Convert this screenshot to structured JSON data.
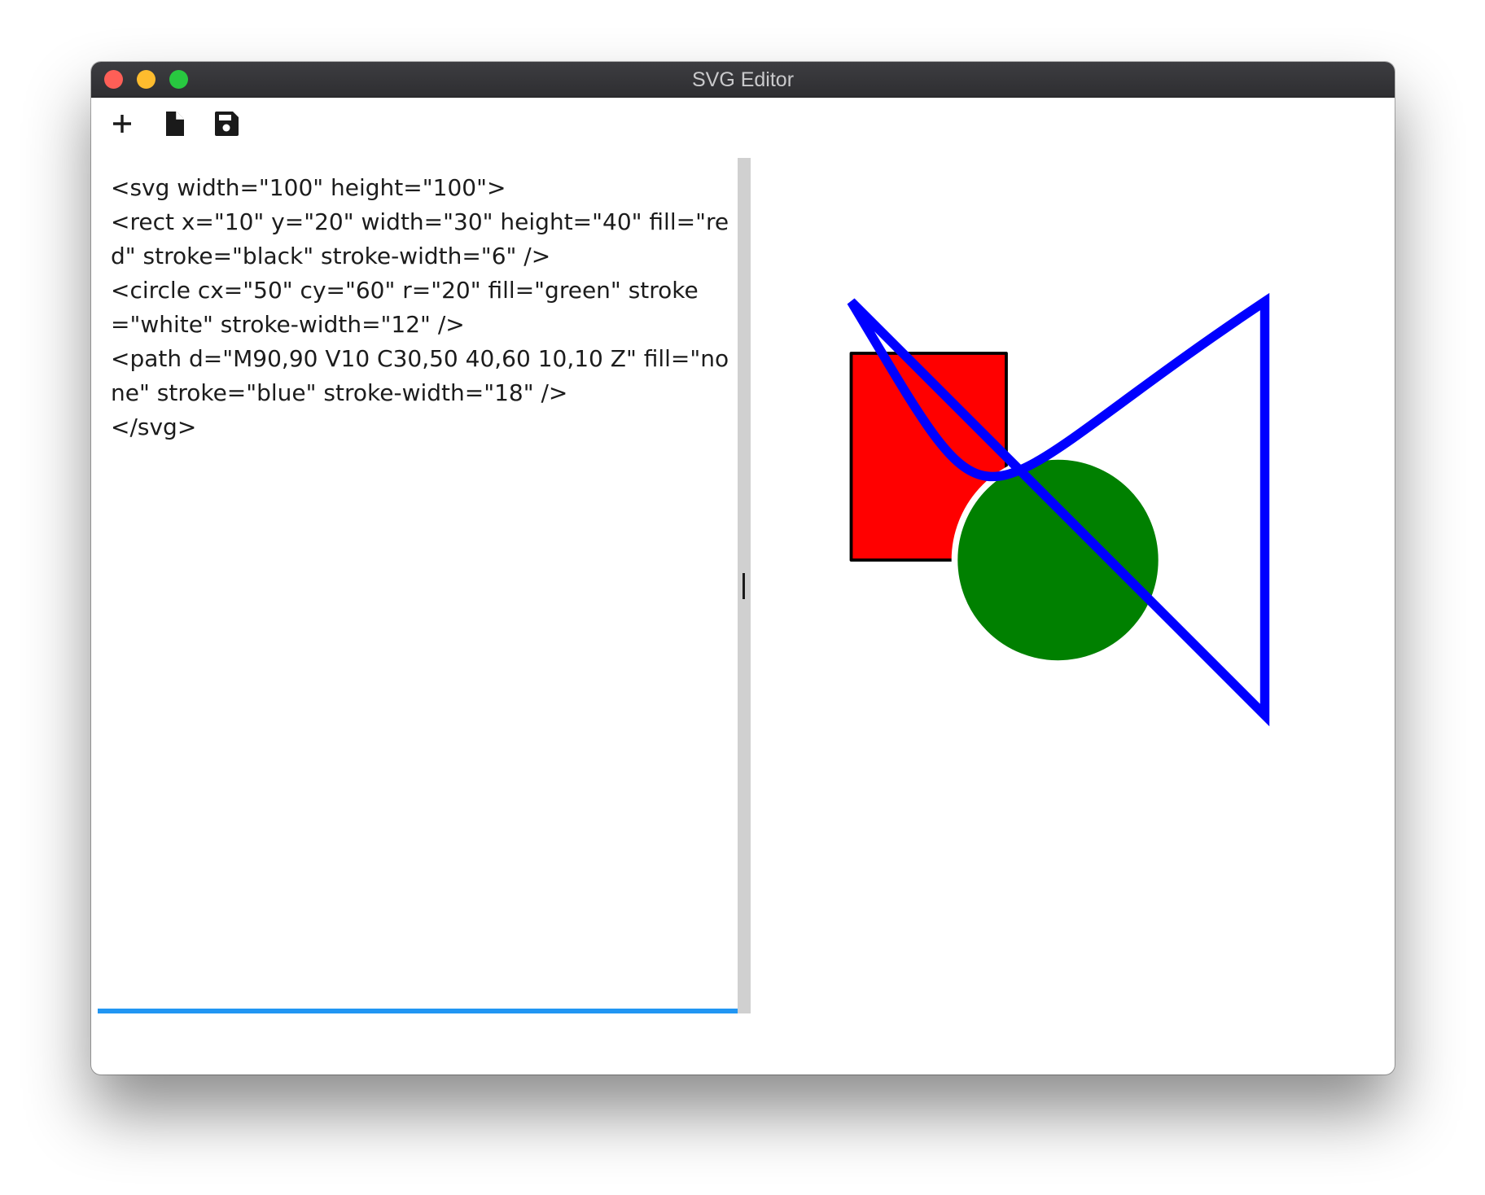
{
  "window": {
    "title": "SVG Editor"
  },
  "toolbar": {
    "items": [
      {
        "name": "new",
        "icon": "plus-icon"
      },
      {
        "name": "open",
        "icon": "file-icon"
      },
      {
        "name": "save",
        "icon": "floppy-disk-icon"
      }
    ]
  },
  "editor": {
    "code": "<svg width=\"100\" height=\"100\">\n<rect x=\"10\" y=\"20\" width=\"30\" height=\"40\" fill=\"red\" stroke=\"black\" stroke-width=\"6\" />\n<circle cx=\"50\" cy=\"60\" r=\"20\" fill=\"green\" stroke=\"white\" stroke-width=\"12\" />\n<path d=\"M90,90 V10 C30,50 40,60 10,10 Z\" fill=\"none\" stroke=\"blue\" stroke-width=\"18\" />\n</svg>"
  },
  "colors": {
    "accent": "#2196f3",
    "titlebar": "#333336",
    "splitter": "#d0d0d0",
    "shape_red": "#ff0000",
    "shape_green": "#008000",
    "shape_blue": "#0000ff"
  }
}
